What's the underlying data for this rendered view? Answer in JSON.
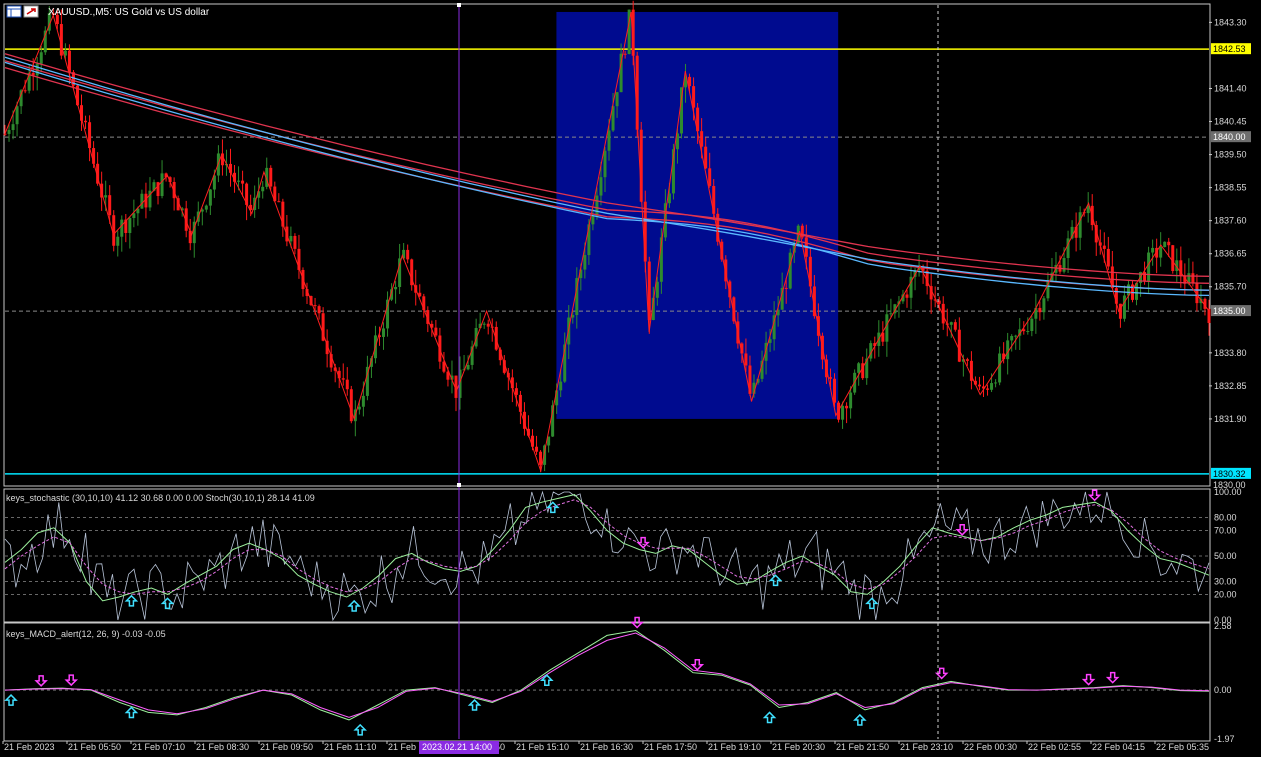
{
  "window": {
    "title": "XAUUSD.,M5:  US Gold vs US dollar"
  },
  "colors": {
    "background": "#000000",
    "bull_candle": "#2e8b2e",
    "bear_candle": "#ff1a1a",
    "zigzag": "#ff2020",
    "ma_red": "#e0344f",
    "ma_blue": "#5ab8ff",
    "highlight_box": "#000b8f",
    "hline_yellow": "#ffff00",
    "hline_cyan": "#00e5ff",
    "grid": "#8a8a8a",
    "stoch_main": "#9cf09c",
    "stoch_signal": "#e070e0",
    "stoch_raw": "#b8c4d8",
    "macd_main": "#9cf09c",
    "macd_signal": "#ff60ff",
    "up_arrow": "#40e0ff",
    "down_arrow": "#ff40ff",
    "time_highlight": "#8a2be2"
  },
  "icons": [
    "chart-window-icon",
    "maximize-icon"
  ],
  "price_axis": {
    "ticks": [
      "1843.30",
      "1841.40",
      "1840.45",
      "1839.50",
      "1838.55",
      "1837.60",
      "1836.65",
      "1835.70",
      "1833.80",
      "1832.85",
      "1831.90"
    ],
    "tick_values": [
      1843.3,
      1841.4,
      1840.45,
      1839.5,
      1838.55,
      1837.6,
      1836.65,
      1835.7,
      1833.8,
      1832.85,
      1831.9
    ],
    "labels": [
      {
        "text": "1842.53",
        "value": 1842.53,
        "type": "yellow"
      },
      {
        "text": "1840.00",
        "value": 1840.0,
        "type": "dashed"
      },
      {
        "text": "1835.00",
        "value": 1835.0,
        "type": "dashed"
      },
      {
        "text": "1830.32",
        "value": 1830.32,
        "type": "cyan"
      },
      {
        "text": "1830.00",
        "value": 1830.0,
        "type": "plain"
      }
    ]
  },
  "stoch_panel": {
    "label": "keys_stochastic (30,10,10) 41.12 30.68 0.00 0.00 Stoch(30,10,1) 28.14 41.09",
    "ticks": [
      "100.00",
      "80.00",
      "70.00",
      "50.00",
      "30.00",
      "20.00",
      "0.00"
    ],
    "tick_values": [
      100,
      80,
      70,
      50,
      30,
      20,
      0
    ]
  },
  "macd_panel": {
    "label": "keys_MACD_alert(12, 26, 9) -0.03 -0.05",
    "ticks": [
      "2.58",
      "0.00",
      "-1.97"
    ],
    "tick_values": [
      2.58,
      0,
      -1.97
    ]
  },
  "time_axis": {
    "labels": [
      "21 Feb 2023",
      "21 Feb 05:50",
      "21 Feb 07:10",
      "21 Feb 08:30",
      "21 Feb 09:50",
      "21 Feb 11:10",
      "21 Feb 12:30",
      "21 Feb 13:50",
      "21 Feb 15:10",
      "21 Feb 16:30",
      "21 Feb 17:50",
      "21 Feb 19:10",
      "21 Feb 20:30",
      "21 Feb 21:50",
      "21 Feb 23:10",
      "22 Feb 00:30",
      "22 Feb 02:55",
      "22 Feb 04:15",
      "22 Feb 05:35"
    ],
    "cursor_label": "2023.02.21 14:00"
  },
  "chart_data": [
    {
      "type": "candlestick",
      "symbol": "XAUUSD.",
      "timeframe": "M5",
      "title": "XAUUSD.,M5:  US Gold vs US dollar",
      "ylim": [
        1830.0,
        1843.8
      ],
      "zigzag": [
        {
          "x": 0.0,
          "y": 1840.1
        },
        {
          "x": 0.04,
          "y": 1843.5
        },
        {
          "x": 0.09,
          "y": 1837.2
        },
        {
          "x": 0.135,
          "y": 1838.9
        },
        {
          "x": 0.155,
          "y": 1837.2
        },
        {
          "x": 0.18,
          "y": 1839.5
        },
        {
          "x": 0.205,
          "y": 1837.8
        },
        {
          "x": 0.215,
          "y": 1839.0
        },
        {
          "x": 0.29,
          "y": 1831.9
        },
        {
          "x": 0.33,
          "y": 1836.6
        },
        {
          "x": 0.375,
          "y": 1832.7
        },
        {
          "x": 0.4,
          "y": 1835.0
        },
        {
          "x": 0.445,
          "y": 1830.4
        },
        {
          "x": 0.52,
          "y": 1843.6
        },
        {
          "x": 0.535,
          "y": 1834.4
        },
        {
          "x": 0.565,
          "y": 1841.9
        },
        {
          "x": 0.62,
          "y": 1832.4
        },
        {
          "x": 0.66,
          "y": 1837.3
        },
        {
          "x": 0.69,
          "y": 1832.0
        },
        {
          "x": 0.76,
          "y": 1836.3
        },
        {
          "x": 0.81,
          "y": 1832.6
        },
        {
          "x": 0.855,
          "y": 1835.0
        },
        {
          "x": 0.9,
          "y": 1838.1
        },
        {
          "x": 0.925,
          "y": 1835.0
        },
        {
          "x": 0.96,
          "y": 1836.9
        },
        {
          "x": 1.0,
          "y": 1835.0
        }
      ],
      "moving_averages": [
        {
          "name": "",
          "color": "red",
          "start": 1842.4,
          "end": 1836.0
        },
        {
          "name": "",
          "color": "blue",
          "start": 1842.3,
          "end": 1835.8
        }
      ],
      "horizontal_lines": [
        1842.53,
        1840.0,
        1835.0,
        1830.32
      ],
      "highlight_box": {
        "x_from": 0.458,
        "x_to": 0.692,
        "y_from": 1831.9,
        "y_to": 1843.6
      }
    },
    {
      "type": "line",
      "name": "keys_stochastic",
      "ylim": [
        0,
        100
      ],
      "series": [
        {
          "values": [
            45,
            55,
            68,
            72,
            60,
            30,
            15,
            18,
            22,
            25,
            20,
            28,
            35,
            42,
            55,
            60,
            55,
            48,
            35,
            28,
            22,
            18,
            25,
            35,
            48,
            52,
            45,
            40,
            38,
            42,
            55,
            70,
            88,
            92,
            95,
            98,
            85,
            70,
            60,
            55,
            52,
            58,
            55,
            45,
            35,
            28,
            30,
            38,
            45,
            50,
            42,
            35,
            22,
            20,
            30,
            42,
            58,
            72,
            68,
            65,
            62,
            65,
            72,
            78,
            82,
            88,
            90,
            92,
            85,
            70,
            58,
            48,
            45,
            40,
            35
          ]
        },
        {
          "values": [
            40,
            50,
            58,
            65,
            60,
            42,
            28,
            22,
            20,
            22,
            22,
            25,
            30,
            38,
            48,
            55,
            55,
            50,
            40,
            32,
            26,
            22,
            24,
            30,
            40,
            48,
            46,
            42,
            40,
            42,
            50,
            62,
            76,
            85,
            90,
            94,
            88,
            76,
            66,
            60,
            56,
            56,
            56,
            50,
            42,
            34,
            32,
            35,
            40,
            46,
            44,
            38,
            28,
            24,
            28,
            38,
            50,
            64,
            66,
            64,
            62,
            64,
            68,
            74,
            78,
            84,
            88,
            90,
            86,
            76,
            64,
            54,
            48,
            44,
            40
          ]
        }
      ],
      "arrows": [
        {
          "x": 0.105,
          "dir": "up"
        },
        {
          "x": 0.135,
          "dir": "up"
        },
        {
          "x": 0.29,
          "dir": "up"
        },
        {
          "x": 0.455,
          "dir": "up"
        },
        {
          "x": 0.53,
          "dir": "down"
        },
        {
          "x": 0.64,
          "dir": "up"
        },
        {
          "x": 0.72,
          "dir": "up"
        },
        {
          "x": 0.795,
          "dir": "down"
        },
        {
          "x": 0.905,
          "dir": "down"
        }
      ]
    },
    {
      "type": "line",
      "name": "keys_MACD_alert",
      "ylim": [
        -1.97,
        2.58
      ],
      "series": [
        {
          "values": [
            0.0,
            0.05,
            0.08,
            0.0,
            -0.5,
            -0.9,
            -1.0,
            -0.7,
            -0.3,
            0.0,
            -0.2,
            -0.8,
            -1.2,
            -0.6,
            0.0,
            0.1,
            -0.2,
            -0.5,
            0.0,
            0.8,
            1.5,
            2.2,
            2.4,
            1.6,
            0.7,
            0.6,
            0.2,
            -0.7,
            -0.5,
            -0.1,
            -0.8,
            -0.5,
            0.1,
            0.35,
            0.15,
            0.0,
            0.0,
            0.05,
            0.1,
            0.18,
            0.1,
            -0.02,
            -0.05
          ]
        },
        {
          "values": [
            0.0,
            0.04,
            0.06,
            0.02,
            -0.4,
            -0.8,
            -0.95,
            -0.75,
            -0.35,
            0.0,
            -0.15,
            -0.7,
            -1.1,
            -0.7,
            -0.05,
            0.08,
            -0.15,
            -0.45,
            -0.05,
            0.7,
            1.4,
            2.0,
            2.3,
            1.7,
            0.8,
            0.65,
            0.25,
            -0.6,
            -0.55,
            -0.15,
            -0.7,
            -0.55,
            0.05,
            0.3,
            0.18,
            0.02,
            0.0,
            0.04,
            0.08,
            0.15,
            0.12,
            0.0,
            -0.03
          ]
        }
      ],
      "arrows": [
        {
          "x": 0.005,
          "dir": "up"
        },
        {
          "x": 0.03,
          "dir": "down"
        },
        {
          "x": 0.055,
          "dir": "down"
        },
        {
          "x": 0.105,
          "dir": "up"
        },
        {
          "x": 0.295,
          "dir": "up"
        },
        {
          "x": 0.39,
          "dir": "up"
        },
        {
          "x": 0.45,
          "dir": "up"
        },
        {
          "x": 0.525,
          "dir": "down"
        },
        {
          "x": 0.575,
          "dir": "down"
        },
        {
          "x": 0.635,
          "dir": "up"
        },
        {
          "x": 0.71,
          "dir": "up"
        },
        {
          "x": 0.778,
          "dir": "down"
        },
        {
          "x": 0.9,
          "dir": "down"
        },
        {
          "x": 0.92,
          "dir": "down"
        }
      ]
    }
  ]
}
